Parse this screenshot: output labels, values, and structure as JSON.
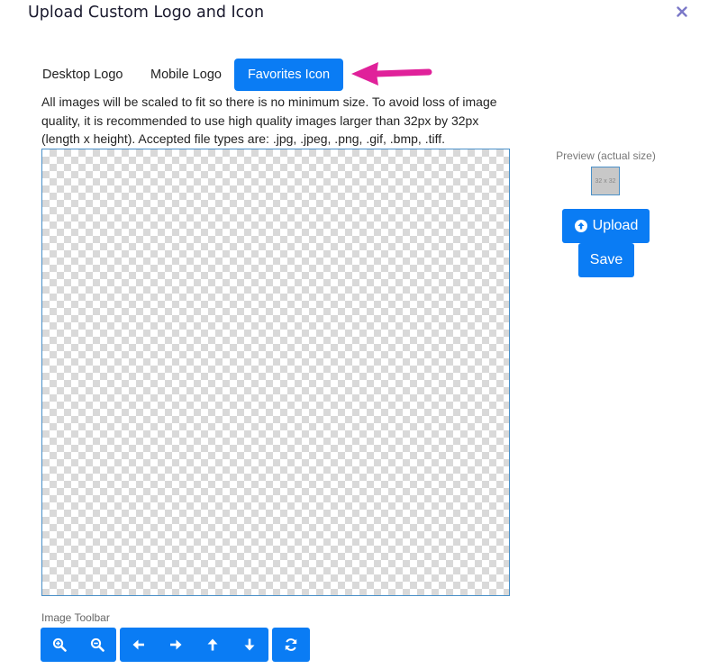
{
  "dialog": {
    "title": "Upload Custom Logo and Icon",
    "close_icon": "close-icon"
  },
  "tabs": [
    {
      "label": "Desktop Logo",
      "active": false
    },
    {
      "label": "Mobile Logo",
      "active": false
    },
    {
      "label": "Favorites Icon",
      "active": true
    }
  ],
  "description": "All images will be scaled to fit so there is no minimum size. To avoid loss of image quality, it is recommended to use high quality images larger than 32px by 32px (length x height). Accepted file types are: .jpg, .jpeg, .png, .gif, .bmp, .tiff.",
  "preview": {
    "label": "Preview (actual size)",
    "placeholder": "32 x 32"
  },
  "buttons": {
    "upload_label": "Upload",
    "save_label": "Save"
  },
  "toolbar": {
    "label": "Image Toolbar",
    "tools": [
      "zoom-in-icon",
      "zoom-out-icon",
      "arrow-left-icon",
      "arrow-right-icon",
      "arrow-up-icon",
      "arrow-down-icon",
      "rotate-icon"
    ]
  },
  "colors": {
    "accent": "#0a7cf4",
    "annotation_arrow": "#e0219a",
    "close_icon": "#7b78c8"
  }
}
